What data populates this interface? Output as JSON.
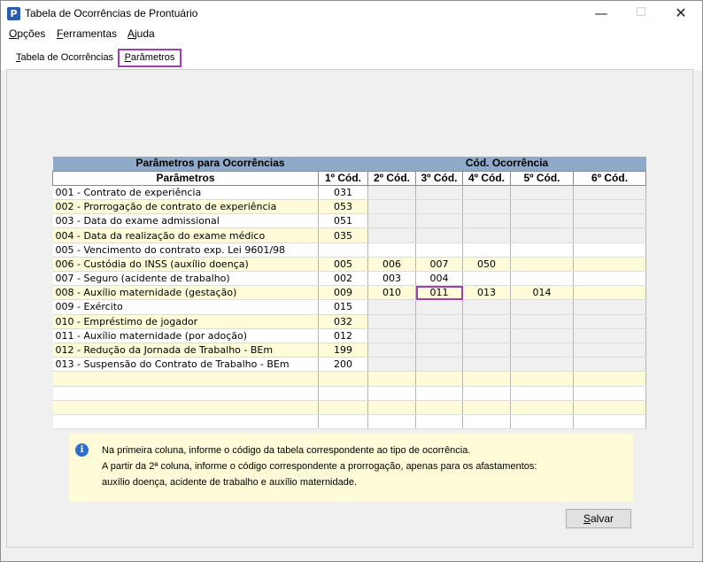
{
  "window": {
    "title": "Tabela de Ocorrências de Prontuário",
    "app_icon_letter": "P",
    "minimize_glyph": "—",
    "maximize_glyph": "☐",
    "close_glyph": "✕"
  },
  "menu": [
    {
      "first": "O",
      "rest": "pções"
    },
    {
      "first": "F",
      "rest": "erramentas"
    },
    {
      "first": "A",
      "rest": "juda"
    }
  ],
  "tabs": {
    "tab1_first": "T",
    "tab1_rest": "abela de Ocorrências",
    "tab2_first": "P",
    "tab2_rest": "arâmetros"
  },
  "grid": {
    "group_headers": [
      "Parâmetros para Ocorrências",
      "Cód. Ocorrência"
    ],
    "columns": [
      "Parâmetros",
      "1º Cód.",
      "2º Cód.",
      "3º Cód.",
      "4º Cód.",
      "5º Cód.",
      "6º Cód."
    ],
    "rows": [
      {
        "name": "001 - Contrato de experiência",
        "codes": [
          "031",
          "",
          "",
          "",
          "",
          ""
        ]
      },
      {
        "name": "002 - Prorrogação de contrato de experiência",
        "codes": [
          "053",
          "",
          "",
          "",
          "",
          ""
        ]
      },
      {
        "name": "003 - Data do exame admissional",
        "codes": [
          "051",
          "",
          "",
          "",
          "",
          ""
        ]
      },
      {
        "name": "004 - Data da realização do exame médico",
        "codes": [
          "035",
          "",
          "",
          "",
          "",
          ""
        ]
      },
      {
        "name": "005 - Vencimento do contrato exp. Lei 9601/98",
        "codes": [
          "",
          "",
          "",
          "",
          "",
          ""
        ]
      },
      {
        "name": "006 - Custódia do INSS (auxílio doença)",
        "codes": [
          "005",
          "006",
          "007",
          "050",
          "",
          ""
        ]
      },
      {
        "name": "007 - Seguro (acidente de trabalho)",
        "codes": [
          "002",
          "003",
          "004",
          "",
          "",
          ""
        ]
      },
      {
        "name": "008 - Auxílio maternidade (gestação)",
        "codes": [
          "009",
          "010",
          "011",
          "013",
          "014",
          ""
        ]
      },
      {
        "name": "009 - Exército",
        "codes": [
          "015",
          "",
          "",
          "",
          "",
          ""
        ]
      },
      {
        "name": "010 - Empréstimo de jogador",
        "codes": [
          "032",
          "",
          "",
          "",
          "",
          ""
        ]
      },
      {
        "name": "011 - Auxílio maternidade (por adoção)",
        "codes": [
          "012",
          "",
          "",
          "",
          "",
          ""
        ]
      },
      {
        "name": "012 - Redução da Jornada de Trabalho - BEm",
        "codes": [
          "199",
          "",
          "",
          "",
          "",
          ""
        ]
      },
      {
        "name": "013 - Suspensão do Contrato de Trabalho - BEm",
        "codes": [
          "200",
          "",
          "",
          "",
          "",
          ""
        ]
      }
    ],
    "selected": {
      "row": 7,
      "col": 2
    },
    "blank_rows": 4
  },
  "info": {
    "icon": "i",
    "line1": "Na primeira coluna, informe o código da tabela correspondente ao tipo de ocorrência.",
    "line2": "A partir da 2ª coluna, informe o código correspondente a prorrogação, apenas para os afastamentos:",
    "line3": "auxílio doença, acidente de trabalho e auxílio maternidade."
  },
  "save_button": {
    "first": "S",
    "rest": "alvar"
  },
  "colors": {
    "header_blue": "#8fa9c8",
    "row_yellow": "#fdfbd8",
    "selection_purple": "#a040b0",
    "icon_blue": "#2d6fcf"
  }
}
